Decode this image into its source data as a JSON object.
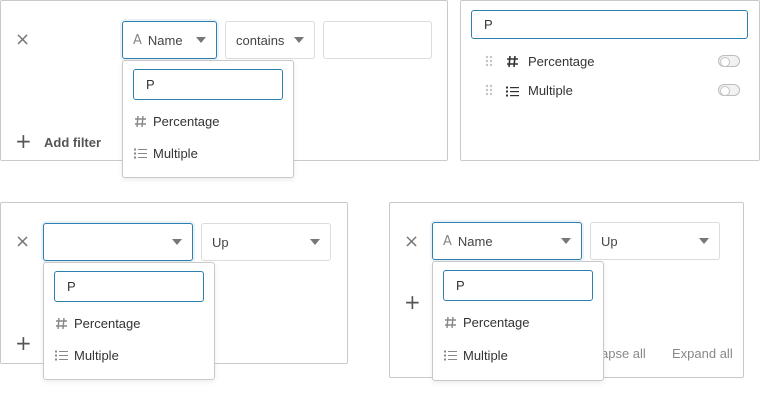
{
  "filters": {
    "remove_symbol": "×",
    "add_symbol": "+",
    "field_selected": "Name",
    "condition": "contains",
    "value": "",
    "add_filter_label": "Add filter"
  },
  "field_dropdown": {
    "search_value": "P",
    "options": [
      {
        "label": "Percentage",
        "icon": "hash-icon"
      },
      {
        "label": "Multiple",
        "icon": "list-icon"
      }
    ]
  },
  "field_list": {
    "search_value": "P",
    "items": [
      {
        "label": "Percentage",
        "icon": "hash-icon",
        "toggle_on": false
      },
      {
        "label": "Multiple",
        "icon": "list-icon",
        "toggle_on": false
      }
    ]
  },
  "sort": {
    "field_selected": "",
    "direction": "Up"
  },
  "group": {
    "field_selected": "Name",
    "direction": "Up",
    "collapse_all_label": "apse all",
    "expand_all_label": "Expand all"
  },
  "colors": {
    "focus": "#2d7fb0",
    "border": "#c9c9c9"
  }
}
